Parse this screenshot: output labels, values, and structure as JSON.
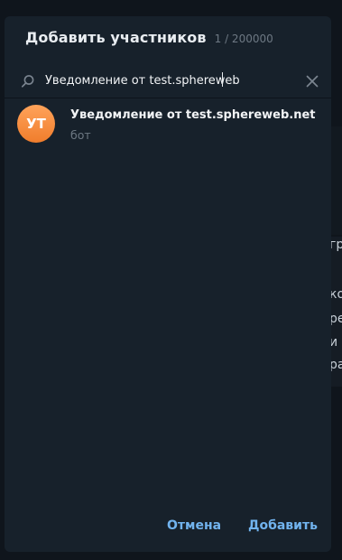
{
  "background": {
    "fragments": [
      "гр",
      "ко",
      "ре",
      "и",
      "ра"
    ]
  },
  "dialog": {
    "title": "Добавить участников",
    "counter": "1 / 200000",
    "search": {
      "value": "Уведомление от test.sphereweb",
      "icon": "search-icon",
      "clear_icon": "close-icon"
    },
    "results": [
      {
        "initials": "УТ",
        "name": "Уведомление от test.sphereweb.net",
        "subtitle": "бот",
        "avatar_color": "#f5913e"
      }
    ],
    "buttons": {
      "cancel": "Отмена",
      "add": "Добавить"
    }
  },
  "colors": {
    "accent": "#71b3ee",
    "dialog_bg": "#17212b",
    "muted_text": "#6d7883"
  }
}
